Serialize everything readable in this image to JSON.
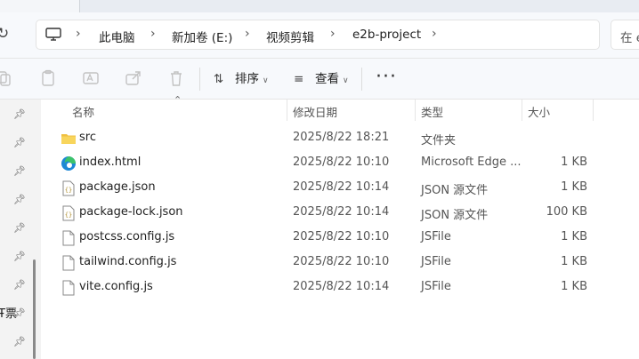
{
  "address": {
    "breadcrumbs": [
      "此电脑",
      "新加卷 (E:)",
      "视频剪辑",
      "e2b-project"
    ],
    "search_placeholder_visible": "在 e"
  },
  "toolbar": {
    "sort_label": "排序",
    "view_label": "查看",
    "more_label": "···"
  },
  "nav": {
    "partial_label": "Ŧ票"
  },
  "columns": {
    "name": "名称",
    "modified": "修改日期",
    "type": "类型",
    "size": "大小"
  },
  "files": [
    {
      "name": "src",
      "modified": "2025/8/22 18:21",
      "type": "文件夹",
      "size": "",
      "icon": "folder-icon"
    },
    {
      "name": "index.html",
      "modified": "2025/8/22 10:10",
      "type": "Microsoft Edge ...",
      "size": "1 KB",
      "icon": "edge-icon"
    },
    {
      "name": "package.json",
      "modified": "2025/8/22 10:14",
      "type": "JSON 源文件",
      "size": "1 KB",
      "icon": "json-file-icon"
    },
    {
      "name": "package-lock.json",
      "modified": "2025/8/22 10:14",
      "type": "JSON 源文件",
      "size": "100 KB",
      "icon": "json-file-icon"
    },
    {
      "name": "postcss.config.js",
      "modified": "2025/8/22 10:10",
      "type": "JSFile",
      "size": "1 KB",
      "icon": "file-icon"
    },
    {
      "name": "tailwind.config.js",
      "modified": "2025/8/22 10:10",
      "type": "JSFile",
      "size": "1 KB",
      "icon": "file-icon"
    },
    {
      "name": "vite.config.js",
      "modified": "2025/8/22 10:14",
      "type": "JSFile",
      "size": "1 KB",
      "icon": "file-icon"
    }
  ]
}
